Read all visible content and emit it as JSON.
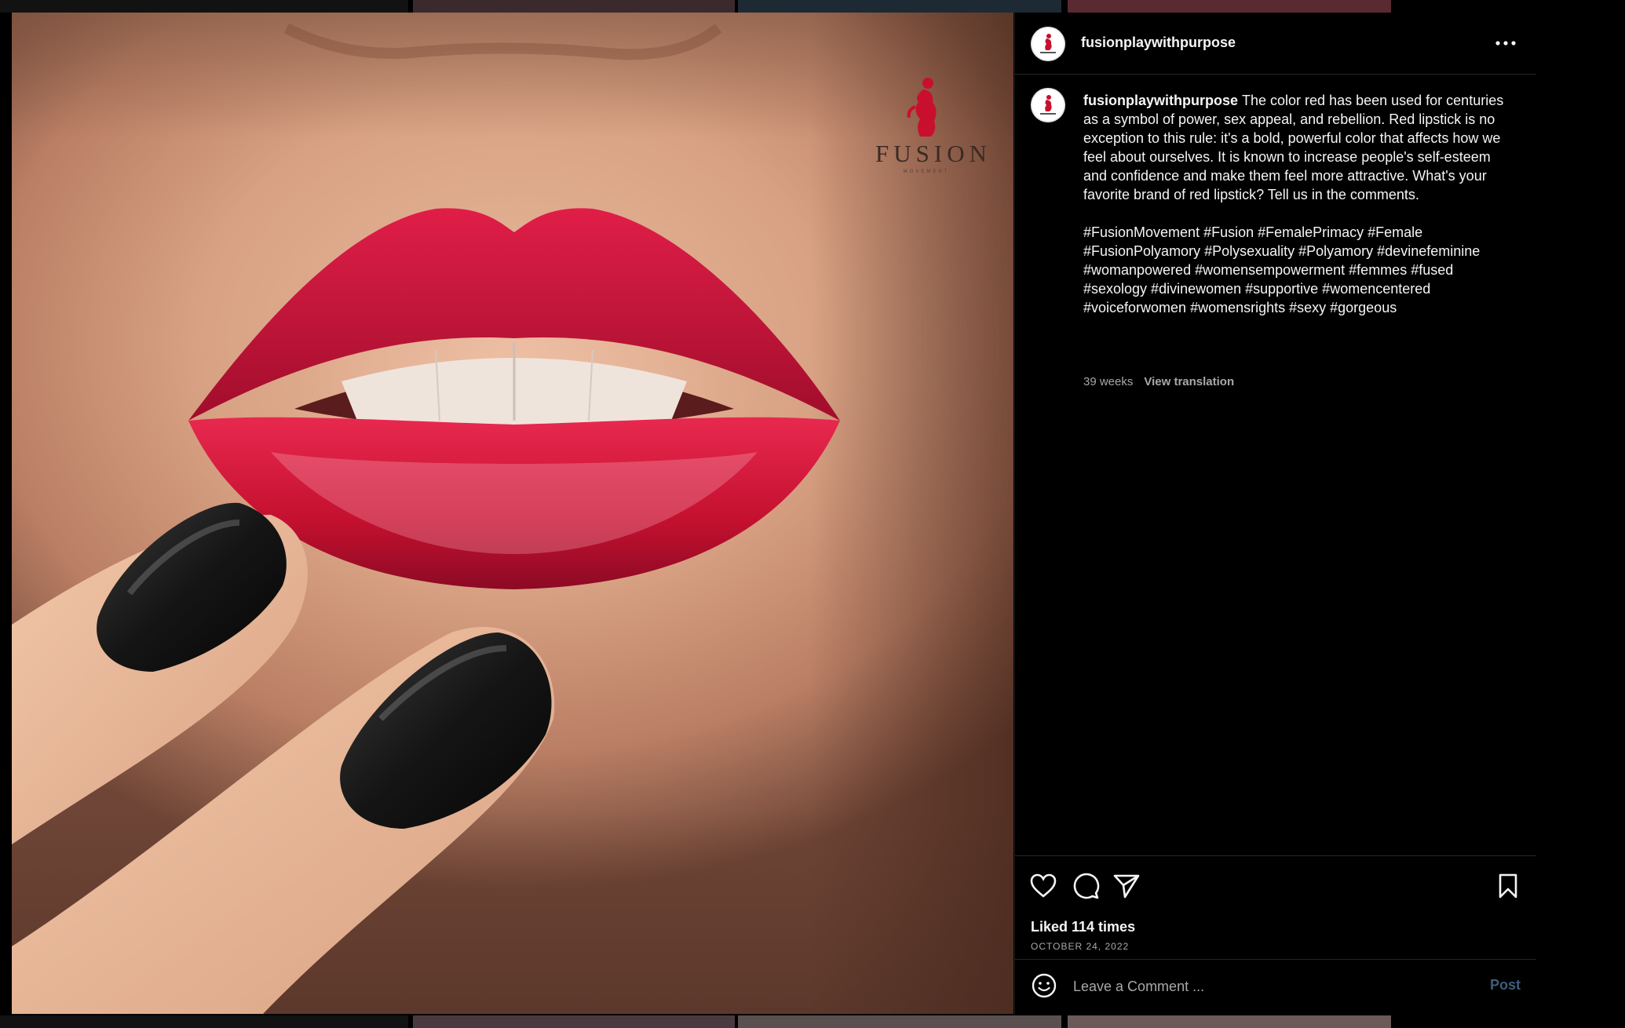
{
  "post": {
    "username": "fusionplaywithpurpose",
    "more_icon": "more-horizontal-icon",
    "brand": {
      "name": "FUSION",
      "subtitle": "MOVEMENT"
    },
    "caption": "The color red has been used for centuries as a symbol of power, sex appeal, and rebellion. Red lipstick is no exception to this rule: it's a bold, powerful color that affects how we feel about ourselves. It is known to increase people's self-esteem and confidence and make them feel more attractive. What's your favorite brand of red lipstick? Tell us in the comments.",
    "hashtags": "#FusionMovement #Fusion #FemalePrimacy #Female #FusionPolyamory #Polysexuality #Polyamory #devinefeminine #womanpowered #womensempowerment #femmes #fused #sexology #divinewomen #supportive #womencentered #voiceforwomen #womensrights #sexy #gorgeous",
    "age": "39 weeks",
    "view_translation": "View translation",
    "likes": "Liked 114 times",
    "date": "OCTOBER 24, 2022",
    "comment_placeholder": "Leave a Comment ...",
    "post_label": "Post"
  },
  "icons": {
    "like": "heart-icon",
    "comment": "comment-icon",
    "share": "send-icon",
    "save": "bookmark-icon",
    "emoji": "emoji-icon"
  },
  "colors": {
    "background": "#000000",
    "text": "#f5f5f5",
    "muted": "#a8a8a8",
    "divider": "#262626",
    "post_button_disabled": "#3f5c7a",
    "lipstick": "#c8102e",
    "nail_polish": "#111111"
  }
}
